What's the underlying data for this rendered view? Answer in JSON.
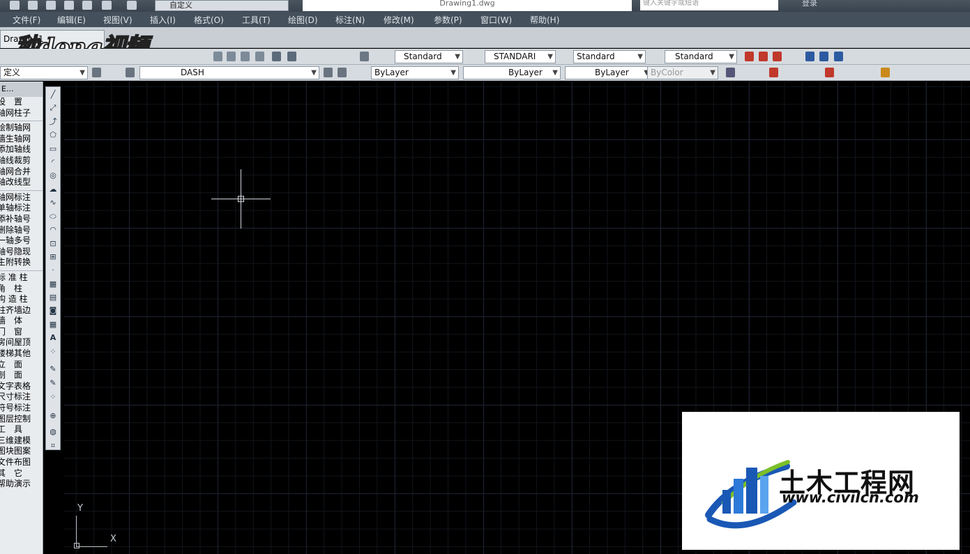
{
  "quick_access": {
    "workspace": "自定义",
    "file_title": "Drawing1.dwg",
    "search_placeholder": "键入关键字或短语",
    "login": "登录"
  },
  "menu": [
    "文件(F)",
    "编辑(E)",
    "视图(V)",
    "插入(I)",
    "格式(O)",
    "工具(T)",
    "绘图(D)",
    "标注(N)",
    "修改(M)",
    "参数(P)",
    "窗口(W)",
    "帮助(H)"
  ],
  "doc_tab": "Drawing1",
  "watermark_top": "秒dong视频",
  "styles": {
    "text_style": "Standard",
    "dim_style": "STANDARI",
    "table_style": "Standard",
    "mleader_style": "Standard"
  },
  "layers": {
    "workspace2": "定义",
    "layer": "DASH",
    "color": "ByLayer",
    "linetype": "ByLayer",
    "lineweight": "ByLayer",
    "plotstyle": "ByColor"
  },
  "left_panel": {
    "header": "E...",
    "items": [
      "设　置",
      "轴网柱子",
      "绘制轴网",
      "墙生轴网",
      "添加轴线",
      "轴线裁剪",
      "轴网合并",
      "轴改线型",
      "轴网标注",
      "单轴标注",
      "添补轴号",
      "删除轴号",
      "一轴多号",
      "轴号隐现",
      "主附转换",
      "标 准 柱",
      "角　柱",
      "构 造 柱",
      "柱齐墙边",
      "墙　体",
      "门　窗",
      "房间屋顶",
      "楼梯其他",
      "立　面",
      "剖　面",
      "文字表格",
      "尺寸标注",
      "符号标注",
      "图层控制",
      "工　具",
      "三维建模",
      "图块图案",
      "文件布图",
      "其　它",
      "帮助演示"
    ]
  },
  "ucs": {
    "y": "Y",
    "x": "X"
  },
  "brand": {
    "name": "土木工程网",
    "url": "www.civilcn.com"
  }
}
